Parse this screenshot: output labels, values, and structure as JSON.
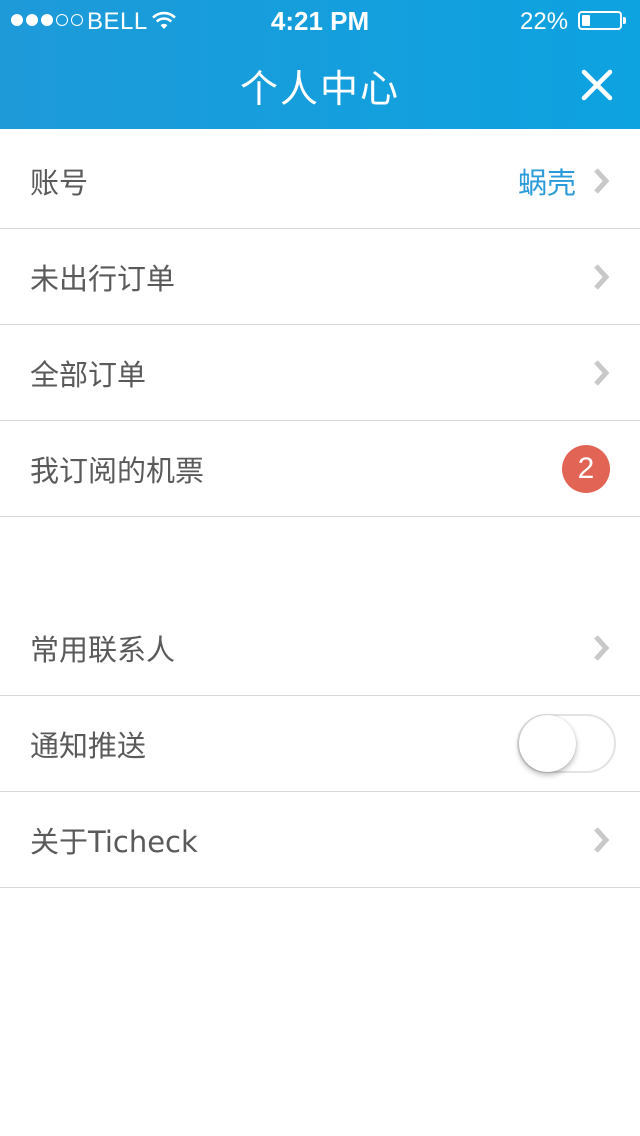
{
  "status_bar": {
    "carrier": "BELL",
    "time": "4:21 PM",
    "battery_percent": "22%",
    "battery_level": 0.22,
    "signal_bars_filled": 3,
    "signal_bars_total": 5
  },
  "header": {
    "title": "个人中心",
    "close_icon": "close-icon",
    "background_color": "#0da2e0"
  },
  "section1": {
    "items": [
      {
        "label": "账号",
        "value": "蜗壳",
        "accessory": "chevron"
      },
      {
        "label": "未出行订单",
        "accessory": "chevron"
      },
      {
        "label": "全部订单",
        "accessory": "chevron"
      },
      {
        "label": "我订阅的机票",
        "badge": "2",
        "accessory": "badge"
      }
    ]
  },
  "section2": {
    "items": [
      {
        "label": "常用联系人",
        "accessory": "chevron"
      },
      {
        "label": "通知推送",
        "accessory": "toggle",
        "toggle_on": false
      },
      {
        "label": "关于Ticheck",
        "accessory": "chevron"
      }
    ]
  },
  "colors": {
    "accent": "#2a9ad8",
    "badge": "#e26454",
    "text": "#5a5a5a",
    "chevron": "#c8c8c8"
  }
}
